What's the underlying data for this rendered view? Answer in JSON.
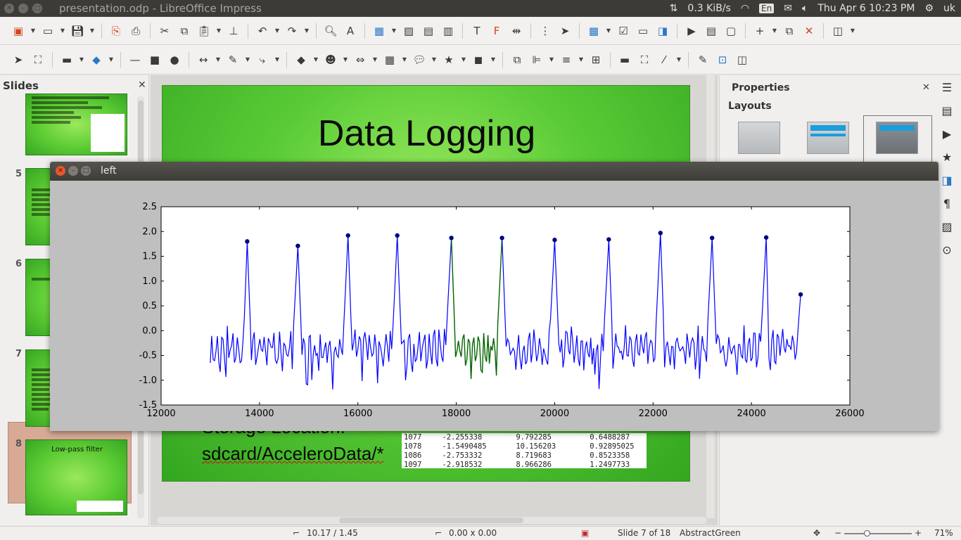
{
  "window": {
    "title": "presentation.odp - LibreOffice Impress"
  },
  "tray": {
    "net_speed": "0.3 KiB/s",
    "lang": "En",
    "datetime": "Thu Apr  6 10:23 PM",
    "user": "uk"
  },
  "slides_panel": {
    "title": "Slides",
    "slides": [
      {
        "num": "5"
      },
      {
        "num": "6"
      },
      {
        "num": "7"
      },
      {
        "num": "8",
        "title": "Low-pass filter"
      }
    ]
  },
  "slide": {
    "title": "Data Logging",
    "partial_line": "Storage Location:",
    "path": "sdcard/AcceleroData/*",
    "table": [
      [
        "1077",
        "-2.255338",
        "9.792285",
        "0.6488287"
      ],
      [
        "1078",
        "-1.5490485",
        "10.156203",
        "0.92895025"
      ],
      [
        "1086",
        "-2.753332",
        "8.719683",
        "0.8523358"
      ],
      [
        "1097",
        "-2.918532",
        "8.966286",
        "1.2497733"
      ]
    ]
  },
  "properties": {
    "title": "Properties",
    "layouts_heading": "Layouts"
  },
  "plot_window": {
    "title": "left"
  },
  "chart_data": {
    "type": "line",
    "xlim": [
      12000,
      26000
    ],
    "ylim": [
      -1.5,
      2.5
    ],
    "x_ticks": [
      "12000",
      "14000",
      "16000",
      "18000",
      "20000",
      "22000",
      "24000",
      "26000"
    ],
    "y_ticks": [
      "2.5",
      "2.0",
      "1.5",
      "1.0",
      "0.5",
      "0.0",
      "-0.5",
      "-1.0",
      "-1.5"
    ],
    "grid": false,
    "colors": {
      "signal": "#0000ff",
      "highlight": "#006400",
      "peaks": "#000080"
    },
    "signal_range": [
      13000,
      25000
    ],
    "highlight_range": [
      17900,
      18930
    ],
    "peaks": [
      {
        "x": 13750,
        "y": 1.8
      },
      {
        "x": 14780,
        "y": 1.71
      },
      {
        "x": 15800,
        "y": 1.92
      },
      {
        "x": 16800,
        "y": 1.92
      },
      {
        "x": 17900,
        "y": 1.87
      },
      {
        "x": 18930,
        "y": 1.87
      },
      {
        "x": 20000,
        "y": 1.83
      },
      {
        "x": 21100,
        "y": 1.84
      },
      {
        "x": 22150,
        "y": 1.97
      },
      {
        "x": 23200,
        "y": 1.87
      },
      {
        "x": 24300,
        "y": 1.88
      },
      {
        "x": 25000,
        "y": 0.73
      }
    ]
  },
  "statusbar": {
    "position": "10.17 / 1.45",
    "size": "0.00 x 0.00",
    "slide_info": "Slide 7 of 18",
    "master": "AbstractGreen",
    "zoom": "71%"
  }
}
